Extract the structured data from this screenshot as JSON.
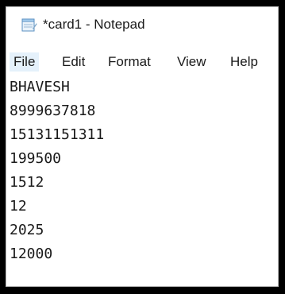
{
  "window": {
    "title": "*card1 - Notepad",
    "app_icon": "notepad-icon"
  },
  "menu": {
    "file": "File",
    "edit": "Edit",
    "format": "Format",
    "view": "View",
    "help": "Help"
  },
  "editor": {
    "lines": [
      "BHAVESH",
      "8999637818",
      "15131151311",
      "199500",
      "1512",
      "12",
      "2025",
      "12000"
    ]
  },
  "colors": {
    "frame_border": "#000000",
    "menu_hover_bg": "#e5f1fb",
    "text": "#1a1a1a"
  }
}
